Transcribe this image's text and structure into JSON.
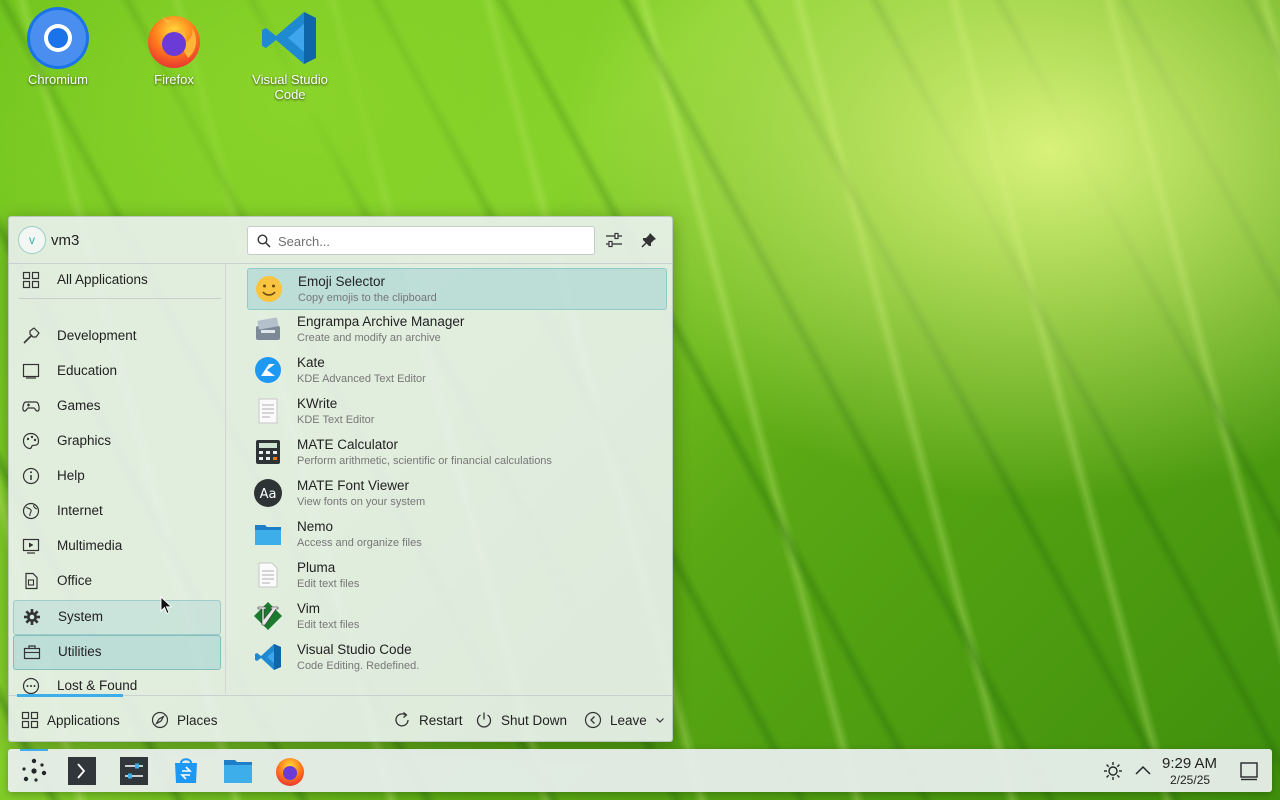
{
  "desktop": {
    "icons": [
      {
        "label": "Chromium",
        "icon": "chromium-icon"
      },
      {
        "label": "Firefox",
        "icon": "firefox-icon"
      },
      {
        "label": "Visual Studio Code",
        "icon": "vscode-icon"
      }
    ]
  },
  "launcher": {
    "user": {
      "name": "vm3",
      "avatar_letter": "v"
    },
    "search": {
      "placeholder": "Search...",
      "value": ""
    },
    "categories": [
      {
        "label": "All Applications",
        "icon": "grid-icon"
      },
      {
        "label": "Development",
        "icon": "hammer-icon"
      },
      {
        "label": "Education",
        "icon": "education-icon"
      },
      {
        "label": "Games",
        "icon": "gamepad-icon"
      },
      {
        "label": "Graphics",
        "icon": "graphics-icon"
      },
      {
        "label": "Help",
        "icon": "help-icon"
      },
      {
        "label": "Internet",
        "icon": "globe-icon"
      },
      {
        "label": "Multimedia",
        "icon": "multimedia-icon"
      },
      {
        "label": "Office",
        "icon": "office-icon"
      },
      {
        "label": "System",
        "icon": "gear-icon"
      },
      {
        "label": "Utilities",
        "icon": "toolbox-icon"
      },
      {
        "label": "Lost & Found",
        "icon": "lost-found-icon"
      }
    ],
    "selected_category": "Utilities",
    "hovered_category": "System",
    "apps": [
      {
        "name": "Emoji Selector",
        "desc": "Copy emojis to the clipboard",
        "icon": "emoji-icon"
      },
      {
        "name": "Engrampa Archive Manager",
        "desc": "Create and modify an archive",
        "icon": "archive-icon"
      },
      {
        "name": "Kate",
        "desc": "KDE Advanced Text Editor",
        "icon": "kate-icon"
      },
      {
        "name": "KWrite",
        "desc": "KDE Text Editor",
        "icon": "kwrite-icon"
      },
      {
        "name": "MATE Calculator",
        "desc": "Perform arithmetic, scientific or financial calculations",
        "icon": "calculator-icon"
      },
      {
        "name": "MATE Font Viewer",
        "desc": "View fonts on your system",
        "icon": "font-viewer-icon",
        "glyph": "Aa"
      },
      {
        "name": "Nemo",
        "desc": "Access and organize files",
        "icon": "folder-icon"
      },
      {
        "name": "Pluma",
        "desc": "Edit text files",
        "icon": "pluma-icon"
      },
      {
        "name": "Vim",
        "desc": "Edit text files",
        "icon": "vim-icon"
      },
      {
        "name": "Visual Studio Code",
        "desc": "Code Editing. Redefined.",
        "icon": "vscode-icon"
      }
    ],
    "footer": {
      "applications": "Applications",
      "places": "Places",
      "restart": "Restart",
      "shutdown": "Shut Down",
      "leave": "Leave"
    }
  },
  "taskbar": {
    "items": [
      "launcher-icon",
      "terminal-icon",
      "settings-icon",
      "discover-icon",
      "file-manager-icon",
      "firefox-icon"
    ],
    "clock": {
      "time": "9:29 AM",
      "date": "2/25/25"
    }
  },
  "colors": {
    "accent": "#3daee9",
    "selection": "#a0d2d2",
    "text": "#222222",
    "subtext": "#777777"
  }
}
